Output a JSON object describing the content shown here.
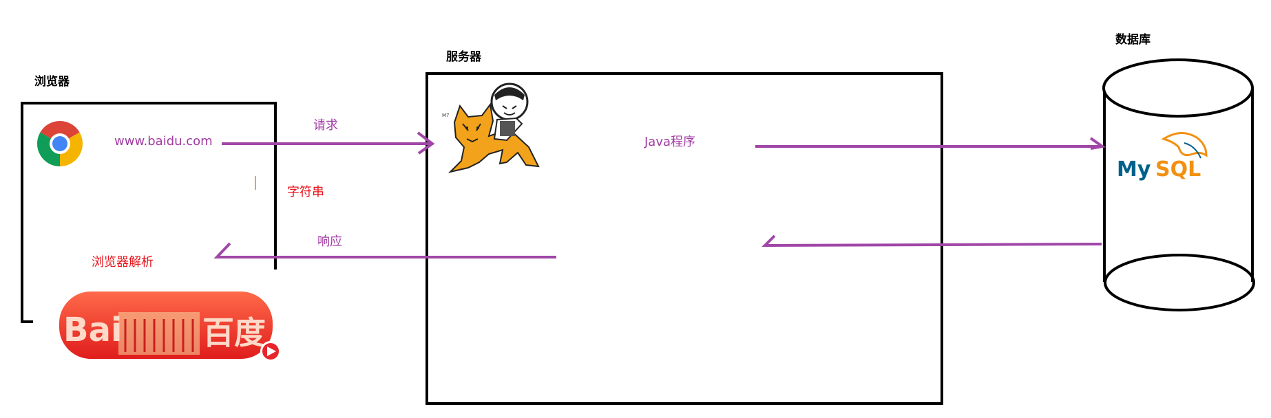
{
  "browser": {
    "title": "浏览器",
    "url": "www.baidu.com",
    "parse_label": "浏览器解析",
    "browser_icon": "chrome-icon",
    "result_logo": "baidu-logo",
    "result_logo_text": {
      "latin": "Bai",
      "chinese": "百度"
    }
  },
  "server": {
    "title": "服务器",
    "program_label": "Java程序",
    "server_icon": "tomcat-mascot-icon"
  },
  "database": {
    "title": "数据库",
    "logo": "mysql-logo",
    "logo_text": {
      "my": "My",
      "sql": "SQL"
    }
  },
  "flows": {
    "request": "请求",
    "string": "字符串",
    "response": "响应"
  },
  "colors": {
    "arrow": "#a047a7",
    "label_purple": "#a23ca3",
    "label_red": "#e8131b",
    "box_stroke": "#000000",
    "baidu_red": "#e6262c"
  }
}
